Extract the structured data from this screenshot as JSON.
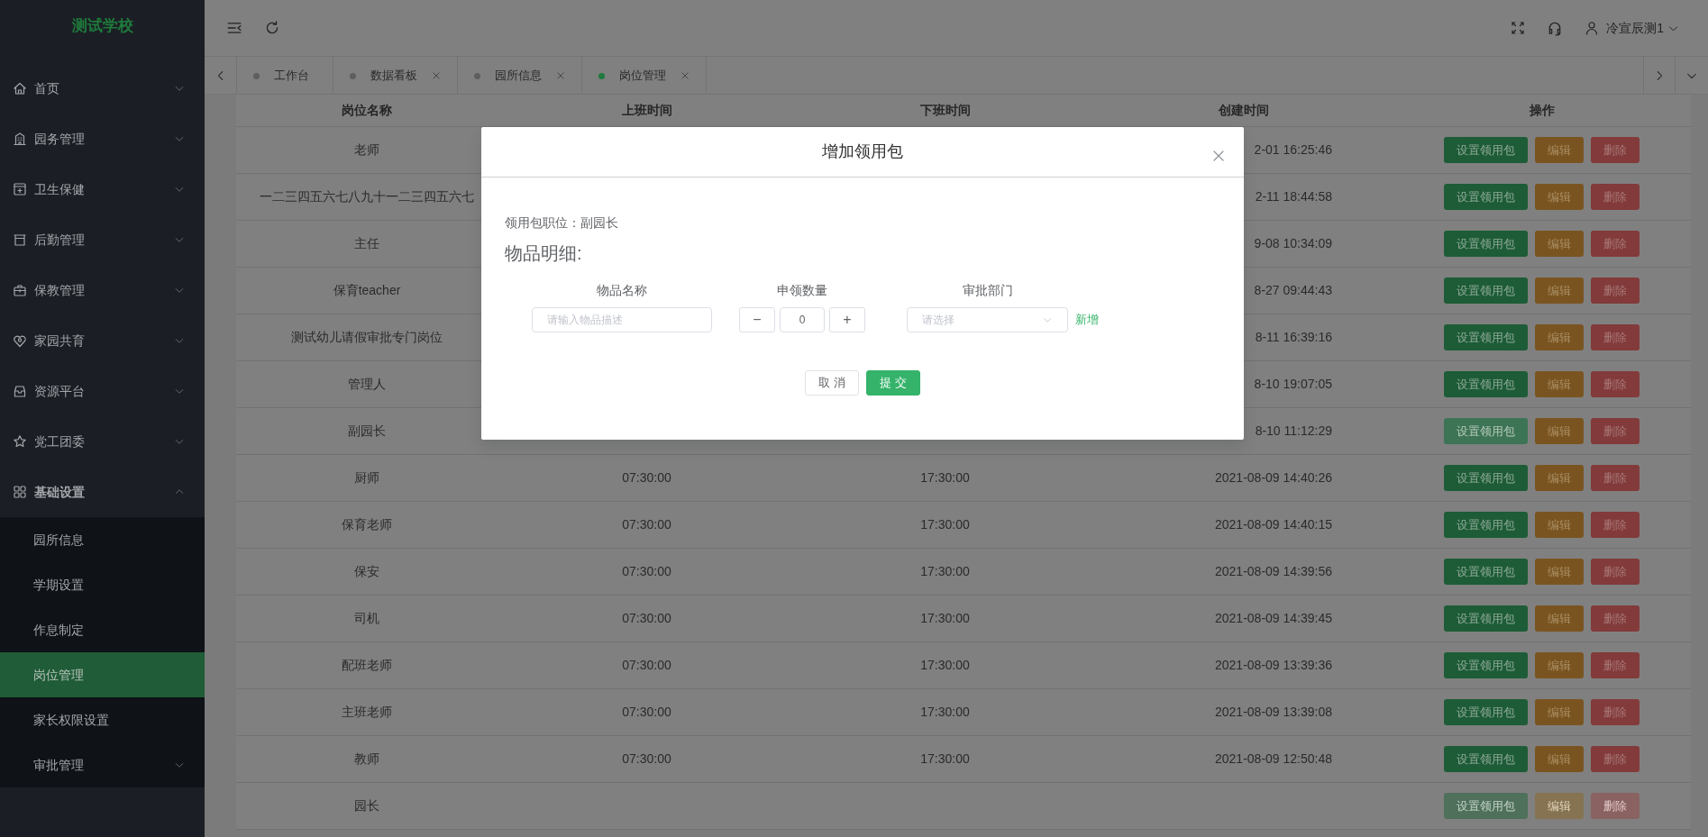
{
  "sidebar": {
    "logo": "测试学校",
    "items": [
      {
        "label": "首页",
        "expanded": false
      },
      {
        "label": "园务管理",
        "expanded": false
      },
      {
        "label": "卫生保健",
        "expanded": false
      },
      {
        "label": "后勤管理",
        "expanded": false
      },
      {
        "label": "保教管理",
        "expanded": false
      },
      {
        "label": "家园共育",
        "expanded": false
      },
      {
        "label": "资源平台",
        "expanded": false
      },
      {
        "label": "党工团委",
        "expanded": false
      },
      {
        "label": "基础设置",
        "expanded": true,
        "children": [
          {
            "label": "园所信息",
            "selected": false
          },
          {
            "label": "学期设置",
            "selected": false
          },
          {
            "label": "作息制定",
            "selected": false
          },
          {
            "label": "岗位管理",
            "selected": true
          },
          {
            "label": "家长权限设置",
            "selected": false
          },
          {
            "label": "审批管理",
            "selected": false,
            "expanded": false
          }
        ]
      }
    ]
  },
  "header": {
    "user": "冷宣辰测1"
  },
  "tabs": [
    {
      "label": "工作台",
      "selected": false,
      "closable": false
    },
    {
      "label": "数据看板",
      "selected": false,
      "closable": true
    },
    {
      "label": "园所信息",
      "selected": false,
      "closable": true
    },
    {
      "label": "岗位管理",
      "selected": true,
      "closable": true
    }
  ],
  "table": {
    "columns": [
      "岗位名称",
      "上班时间",
      "下班时间",
      "创建时间",
      "操作"
    ],
    "rows": [
      {
        "name": "老师",
        "created": "2-01 16:25:46",
        "actions": [
          "设置领用包",
          "编辑",
          "删除"
        ],
        "hovered": false,
        "disabled": false
      },
      {
        "name": "一二三四五六七八九十一二三四五六七",
        "created": "2-11 18:44:58",
        "actions": [
          "设置领用包",
          "编辑",
          "删除"
        ],
        "hovered": false,
        "disabled": false
      },
      {
        "name": "主任",
        "created": "9-08 10:34:09",
        "actions": [
          "设置领用包",
          "编辑",
          "删除"
        ],
        "hovered": false,
        "disabled": false
      },
      {
        "name": "保育teacher",
        "created": "8-27 09:44:43",
        "actions": [
          "设置领用包",
          "编辑",
          "删除"
        ],
        "hovered": false,
        "disabled": false
      },
      {
        "name": "测试幼儿请假审批专门岗位",
        "created": "8-11 16:39:16",
        "actions": [
          "设置领用包",
          "编辑",
          "删除"
        ],
        "hovered": false,
        "disabled": false
      },
      {
        "name": "管理人",
        "created": "8-10 19:07:05",
        "actions": [
          "设置领用包",
          "编辑",
          "删除"
        ],
        "hovered": false,
        "disabled": false
      },
      {
        "name": "副园长",
        "created": "8-10 11:12:29",
        "actions": [
          "设置领用包",
          "编辑",
          "删除"
        ],
        "hovered": true,
        "disabled": false
      },
      {
        "name": "厨师",
        "start": "07:30:00",
        "end": "17:30:00",
        "created": "2021-08-09 14:40:26",
        "actions": [
          "设置领用包",
          "编辑",
          "删除"
        ],
        "hovered": false,
        "disabled": false
      },
      {
        "name": "保育老师",
        "start": "07:30:00",
        "end": "17:30:00",
        "created": "2021-08-09 14:40:15",
        "actions": [
          "设置领用包",
          "编辑",
          "删除"
        ],
        "hovered": false,
        "disabled": false
      },
      {
        "name": "保安",
        "start": "07:30:00",
        "end": "17:30:00",
        "created": "2021-08-09 14:39:56",
        "actions": [
          "设置领用包",
          "编辑",
          "删除"
        ],
        "hovered": false,
        "disabled": false
      },
      {
        "name": "司机",
        "start": "07:30:00",
        "end": "17:30:00",
        "created": "2021-08-09 14:39:45",
        "actions": [
          "设置领用包",
          "编辑",
          "删除"
        ],
        "hovered": false,
        "disabled": false
      },
      {
        "name": "配班老师",
        "start": "07:30:00",
        "end": "17:30:00",
        "created": "2021-08-09 13:39:36",
        "actions": [
          "设置领用包",
          "编辑",
          "删除"
        ],
        "hovered": false,
        "disabled": false
      },
      {
        "name": "主班老师",
        "start": "07:30:00",
        "end": "17:30:00",
        "created": "2021-08-09 13:39:08",
        "actions": [
          "设置领用包",
          "编辑",
          "删除"
        ],
        "hovered": false,
        "disabled": false
      },
      {
        "name": "教师",
        "start": "07:30:00",
        "end": "17:30:00",
        "created": "2021-08-09 12:50:48",
        "actions": [
          "设置领用包",
          "编辑",
          "删除"
        ],
        "hovered": false,
        "disabled": false
      },
      {
        "name": "园长",
        "actions": [
          "设置领用包",
          "编辑",
          "删除"
        ],
        "hovered": false,
        "disabled": true
      }
    ]
  },
  "dialog": {
    "title": "增加领用包",
    "position_line": "领用包职位：副园长",
    "section": "物品明细:",
    "columns": [
      "物品名称",
      "申领数量",
      "审批部门"
    ],
    "item_placeholder": "请输入物品描述",
    "minus": "−",
    "quantity": "0",
    "plus": "+",
    "department_placeholder": "请选择",
    "add_link": "新增",
    "buttons": [
      "取 消",
      "提 交"
    ]
  }
}
